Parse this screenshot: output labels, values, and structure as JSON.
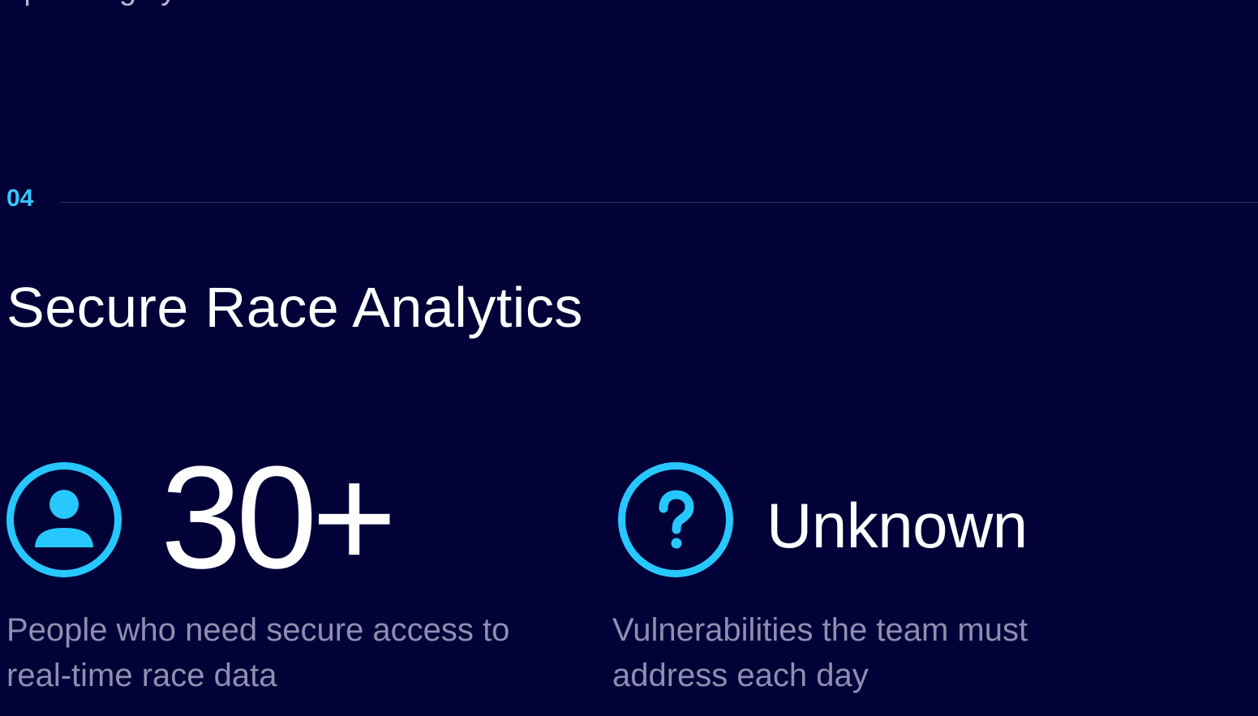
{
  "previous_section": {
    "partial_text": "operating system"
  },
  "section": {
    "number": "04",
    "title": "Secure Race Analytics"
  },
  "stats": [
    {
      "icon": "user-icon",
      "value": "30+",
      "description": "People who need secure access to real-time race data"
    },
    {
      "icon": "question-icon",
      "value": "Unknown",
      "description": "Vulnerabilities the team must address each day"
    }
  ],
  "colors": {
    "background": "#020238",
    "accent": "#27c8ff",
    "title": "#ffffff",
    "description": "#8e8fb0",
    "divider": "#2f3163"
  }
}
